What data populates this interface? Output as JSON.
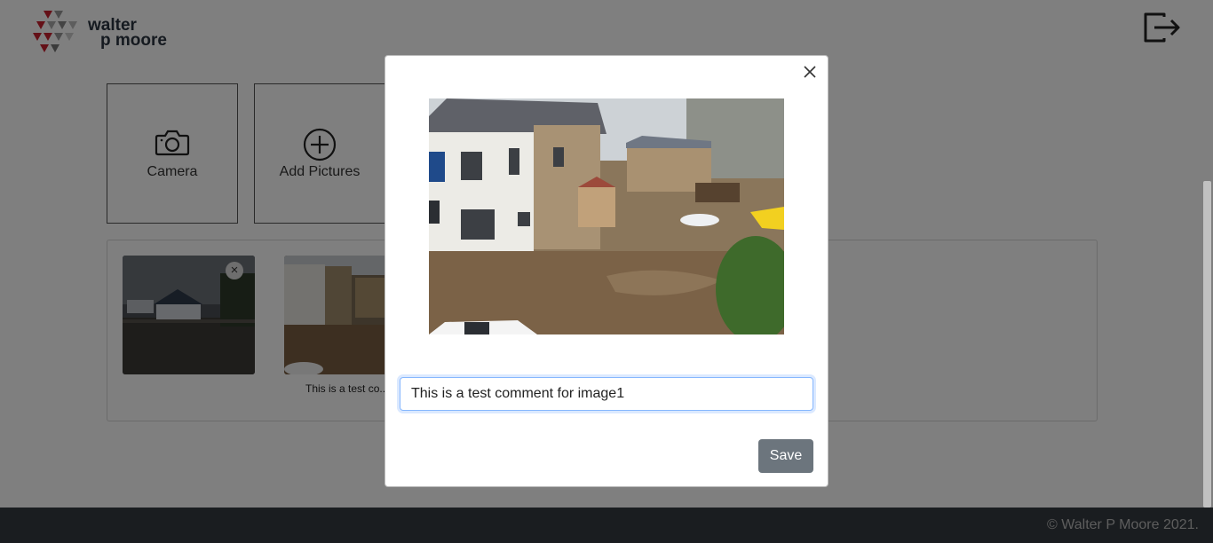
{
  "brand": {
    "line1": "walter",
    "line2": "p moore"
  },
  "tiles": {
    "camera": "Camera",
    "add_pictures": "Add Pictures"
  },
  "gallery": {
    "caption_2": "This is a test co..."
  },
  "icons": {
    "logout": "logout-icon",
    "camera": "camera-icon",
    "add": "plus-circle-icon",
    "close": "close-icon",
    "remove": "remove-circle-icon"
  },
  "modal": {
    "comment_value": "This is a test comment for image1",
    "save_label": "Save"
  },
  "footer": {
    "copyright": "© Walter P Moore 2021."
  },
  "colors": {
    "footer": "#343a40",
    "save_button": "#6c757d",
    "logo_red": "#c8202f"
  }
}
